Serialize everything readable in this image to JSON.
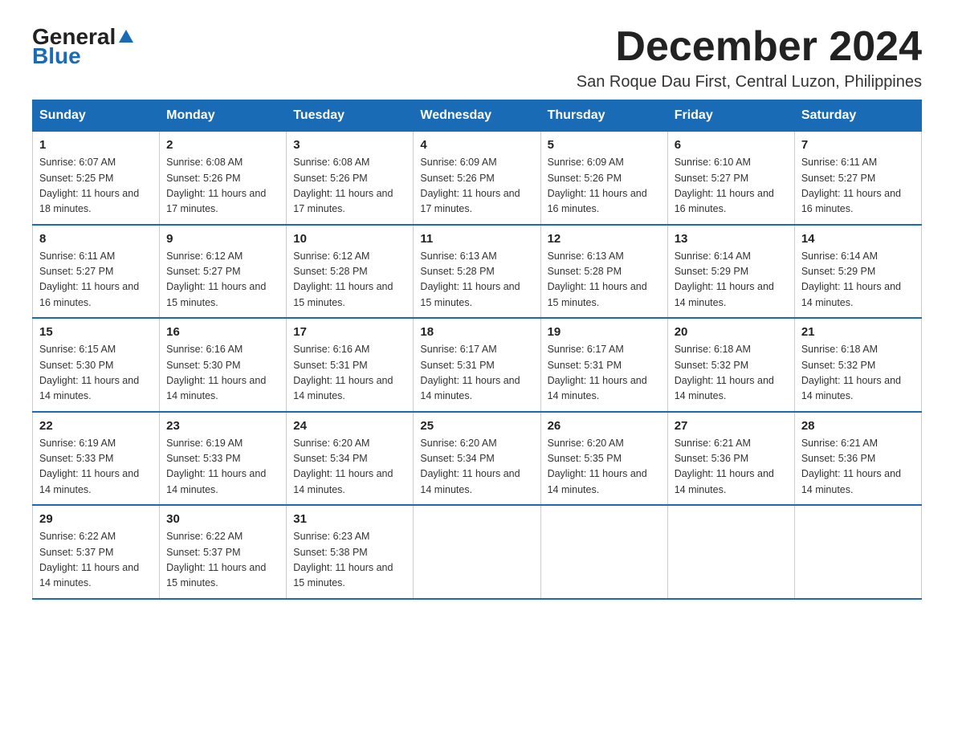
{
  "logo": {
    "text_general": "General",
    "text_blue": "Blue"
  },
  "header": {
    "month_year": "December 2024",
    "subtitle": "San Roque Dau First, Central Luzon, Philippines"
  },
  "days_of_week": [
    "Sunday",
    "Monday",
    "Tuesday",
    "Wednesday",
    "Thursday",
    "Friday",
    "Saturday"
  ],
  "weeks": [
    [
      {
        "day": "1",
        "sunrise": "6:07 AM",
        "sunset": "5:25 PM",
        "daylight": "11 hours and 18 minutes."
      },
      {
        "day": "2",
        "sunrise": "6:08 AM",
        "sunset": "5:26 PM",
        "daylight": "11 hours and 17 minutes."
      },
      {
        "day": "3",
        "sunrise": "6:08 AM",
        "sunset": "5:26 PM",
        "daylight": "11 hours and 17 minutes."
      },
      {
        "day": "4",
        "sunrise": "6:09 AM",
        "sunset": "5:26 PM",
        "daylight": "11 hours and 17 minutes."
      },
      {
        "day": "5",
        "sunrise": "6:09 AM",
        "sunset": "5:26 PM",
        "daylight": "11 hours and 16 minutes."
      },
      {
        "day": "6",
        "sunrise": "6:10 AM",
        "sunset": "5:27 PM",
        "daylight": "11 hours and 16 minutes."
      },
      {
        "day": "7",
        "sunrise": "6:11 AM",
        "sunset": "5:27 PM",
        "daylight": "11 hours and 16 minutes."
      }
    ],
    [
      {
        "day": "8",
        "sunrise": "6:11 AM",
        "sunset": "5:27 PM",
        "daylight": "11 hours and 16 minutes."
      },
      {
        "day": "9",
        "sunrise": "6:12 AM",
        "sunset": "5:27 PM",
        "daylight": "11 hours and 15 minutes."
      },
      {
        "day": "10",
        "sunrise": "6:12 AM",
        "sunset": "5:28 PM",
        "daylight": "11 hours and 15 minutes."
      },
      {
        "day": "11",
        "sunrise": "6:13 AM",
        "sunset": "5:28 PM",
        "daylight": "11 hours and 15 minutes."
      },
      {
        "day": "12",
        "sunrise": "6:13 AM",
        "sunset": "5:28 PM",
        "daylight": "11 hours and 15 minutes."
      },
      {
        "day": "13",
        "sunrise": "6:14 AM",
        "sunset": "5:29 PM",
        "daylight": "11 hours and 14 minutes."
      },
      {
        "day": "14",
        "sunrise": "6:14 AM",
        "sunset": "5:29 PM",
        "daylight": "11 hours and 14 minutes."
      }
    ],
    [
      {
        "day": "15",
        "sunrise": "6:15 AM",
        "sunset": "5:30 PM",
        "daylight": "11 hours and 14 minutes."
      },
      {
        "day": "16",
        "sunrise": "6:16 AM",
        "sunset": "5:30 PM",
        "daylight": "11 hours and 14 minutes."
      },
      {
        "day": "17",
        "sunrise": "6:16 AM",
        "sunset": "5:31 PM",
        "daylight": "11 hours and 14 minutes."
      },
      {
        "day": "18",
        "sunrise": "6:17 AM",
        "sunset": "5:31 PM",
        "daylight": "11 hours and 14 minutes."
      },
      {
        "day": "19",
        "sunrise": "6:17 AM",
        "sunset": "5:31 PM",
        "daylight": "11 hours and 14 minutes."
      },
      {
        "day": "20",
        "sunrise": "6:18 AM",
        "sunset": "5:32 PM",
        "daylight": "11 hours and 14 minutes."
      },
      {
        "day": "21",
        "sunrise": "6:18 AM",
        "sunset": "5:32 PM",
        "daylight": "11 hours and 14 minutes."
      }
    ],
    [
      {
        "day": "22",
        "sunrise": "6:19 AM",
        "sunset": "5:33 PM",
        "daylight": "11 hours and 14 minutes."
      },
      {
        "day": "23",
        "sunrise": "6:19 AM",
        "sunset": "5:33 PM",
        "daylight": "11 hours and 14 minutes."
      },
      {
        "day": "24",
        "sunrise": "6:20 AM",
        "sunset": "5:34 PM",
        "daylight": "11 hours and 14 minutes."
      },
      {
        "day": "25",
        "sunrise": "6:20 AM",
        "sunset": "5:34 PM",
        "daylight": "11 hours and 14 minutes."
      },
      {
        "day": "26",
        "sunrise": "6:20 AM",
        "sunset": "5:35 PM",
        "daylight": "11 hours and 14 minutes."
      },
      {
        "day": "27",
        "sunrise": "6:21 AM",
        "sunset": "5:36 PM",
        "daylight": "11 hours and 14 minutes."
      },
      {
        "day": "28",
        "sunrise": "6:21 AM",
        "sunset": "5:36 PM",
        "daylight": "11 hours and 14 minutes."
      }
    ],
    [
      {
        "day": "29",
        "sunrise": "6:22 AM",
        "sunset": "5:37 PM",
        "daylight": "11 hours and 14 minutes."
      },
      {
        "day": "30",
        "sunrise": "6:22 AM",
        "sunset": "5:37 PM",
        "daylight": "11 hours and 15 minutes."
      },
      {
        "day": "31",
        "sunrise": "6:23 AM",
        "sunset": "5:38 PM",
        "daylight": "11 hours and 15 minutes."
      },
      null,
      null,
      null,
      null
    ]
  ]
}
